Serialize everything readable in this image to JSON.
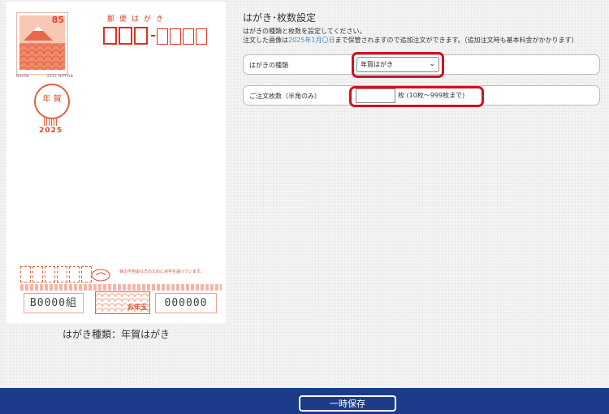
{
  "postcard": {
    "stamp_value": "85",
    "stamp_caption_left": "NIHON",
    "stamp_caption_right": "2025 NIPPON",
    "postmark_text": "年 賀",
    "postmark_year": "2025",
    "postal_label": "郵便はがき",
    "lottery_number": "B0000組",
    "lottery_number2": "000000",
    "lottery_center_label": "お年玉",
    "lottery_text": "目の不自由な方のために点字を設けています。",
    "caption": "はがき種類：年賀はがき"
  },
  "settings": {
    "heading": "はがき･枚数設定",
    "description_line1": "はがきの種類と枚数を設定してください。",
    "description_line2_prefix": "注文した画像は",
    "description_line2_date": "2025年1月〇日",
    "description_line2_suffix": "まで保管されますので追加注文ができます。（追加注文時も基本料金がかかります）",
    "type_label": "はがきの種類",
    "type_selected": "年賀はがき",
    "qty_label": "ご注文枚数（半角のみ）",
    "qty_value": "",
    "qty_unit_text": "枚 (10枚～999枚まで)"
  },
  "footer": {
    "save_label": "一時保存"
  },
  "colors": {
    "footer_bg": "#1c3c8a",
    "highlight": "#d4101e",
    "postal_red": "#e0301e"
  }
}
